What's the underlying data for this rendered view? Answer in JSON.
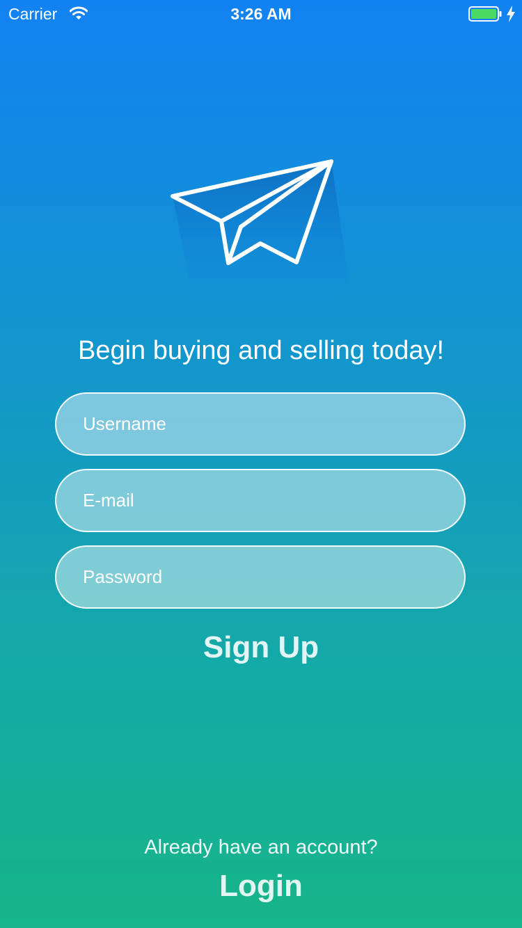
{
  "status_bar": {
    "carrier": "Carrier",
    "time": "3:26 AM",
    "battery_color": "#4cd964"
  },
  "logo": {
    "icon": "paper-plane-icon"
  },
  "tagline": "Begin buying and selling today!",
  "form": {
    "username_placeholder": "Username",
    "email_placeholder": "E-mail",
    "password_placeholder": "Password",
    "signup_label": "Sign Up"
  },
  "footer": {
    "prompt": "Already have an account?",
    "login_label": "Login"
  },
  "colors": {
    "gradient_top": "#1282f2",
    "gradient_bottom": "#17b589"
  }
}
